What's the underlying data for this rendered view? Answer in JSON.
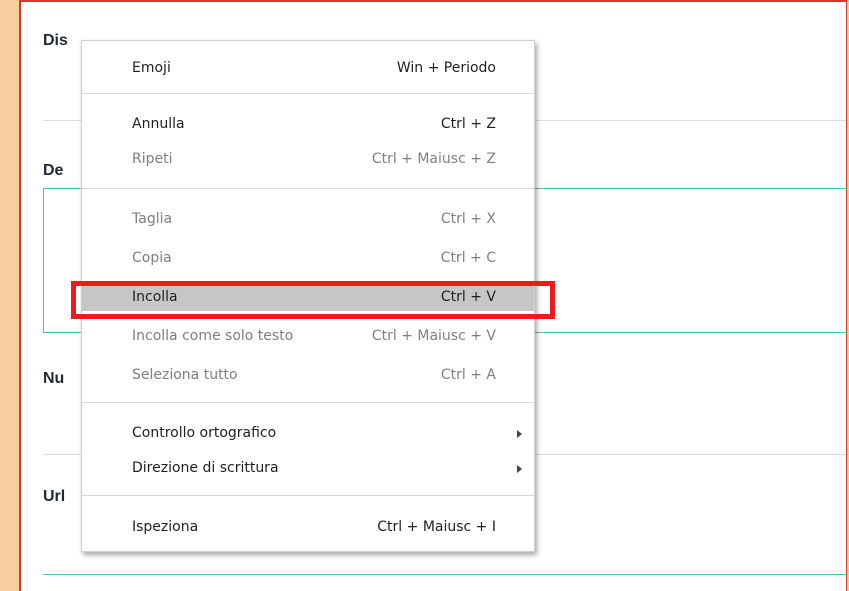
{
  "form": {
    "field1_label": "Dis",
    "field2_label": "De",
    "field3_label": "Nu",
    "field4_label": "Url"
  },
  "context_menu": {
    "items": [
      {
        "label": "Emoji",
        "shortcut": "Win + Periodo",
        "disabled": false
      },
      {
        "label": "Annulla",
        "shortcut": "Ctrl + Z",
        "disabled": false
      },
      {
        "label": "Ripeti",
        "shortcut": "Ctrl + Maiusc + Z",
        "disabled": true
      },
      {
        "label": "Taglia",
        "shortcut": "Ctrl + X",
        "disabled": true
      },
      {
        "label": "Copia",
        "shortcut": "Ctrl + C",
        "disabled": true
      },
      {
        "label": "Incolla",
        "shortcut": "Ctrl + V",
        "disabled": false,
        "selected": true
      },
      {
        "label": "Incolla come solo testo",
        "shortcut": "Ctrl + Maiusc + V",
        "disabled": true
      },
      {
        "label": "Seleziona tutto",
        "shortcut": "Ctrl + A",
        "disabled": true
      },
      {
        "label": "Controllo ortografico",
        "submenu": true,
        "disabled": false
      },
      {
        "label": "Direzione di scrittura",
        "submenu": true,
        "disabled": false
      },
      {
        "label": "Ispeziona",
        "shortcut": "Ctrl + Maiusc + I",
        "disabled": false
      }
    ]
  },
  "colors": {
    "highlight_border": "#ef1b1b",
    "accent_teal": "#4dc2b8",
    "page_frame": "#d33a2f",
    "background_orange": "#f7cf9f"
  }
}
